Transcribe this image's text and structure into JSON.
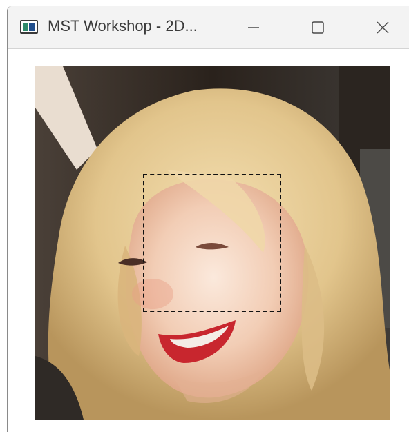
{
  "window": {
    "title": "MST Workshop - 2D...",
    "icons": {
      "app": "app-window-icon",
      "minimize": "minimize-icon",
      "maximize": "maximize-icon",
      "close": "close-icon"
    }
  },
  "image_view": {
    "content": "photo",
    "selection_style": "dashed square"
  }
}
